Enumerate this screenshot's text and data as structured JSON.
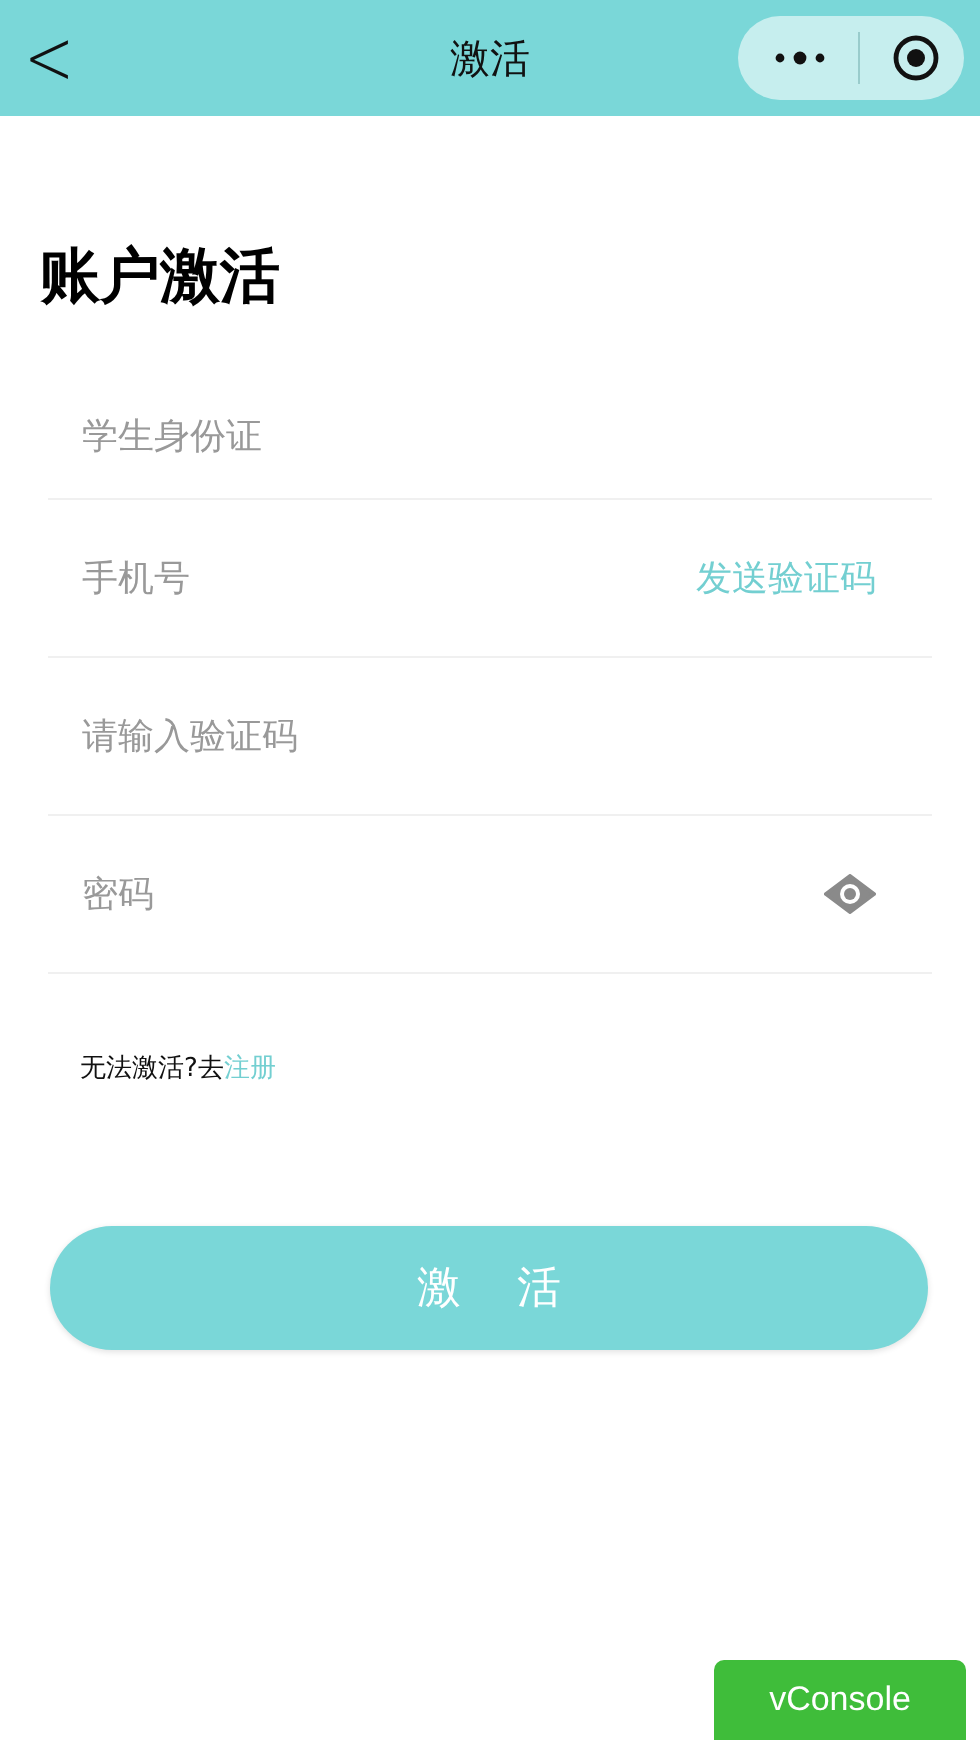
{
  "nav_bar": {
    "back": "<",
    "title": "激活"
  },
  "heading": "账户激活",
  "fields": [
    {
      "kind": "plain",
      "placeholder": "学生身份证"
    },
    {
      "kind": "sms",
      "placeholder": "手机号",
      "action": "发送验证码"
    },
    {
      "kind": "plain",
      "placeholder": "请输入验证码"
    },
    {
      "kind": "password",
      "placeholder": "密码"
    }
  ],
  "prompt": {
    "text": "无法激活?去",
    "link": "注册"
  },
  "submit": "激    活",
  "vconsole": "vConsole"
}
